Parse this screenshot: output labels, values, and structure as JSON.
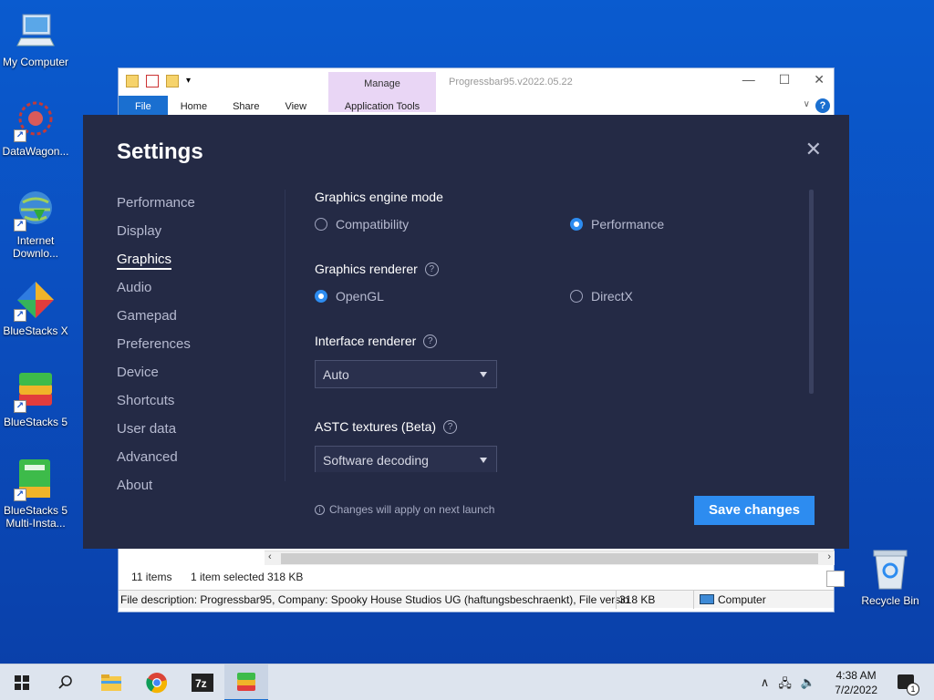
{
  "desktop": {
    "icons": [
      {
        "label": "My Computer"
      },
      {
        "label": "DataWagon..."
      },
      {
        "label": "Internet Downlo..."
      },
      {
        "label": "BlueStacks X"
      },
      {
        "label": "BlueStacks 5"
      },
      {
        "label": "BlueStacks 5 Multi-Insta..."
      }
    ],
    "recycle_bin": "Recycle Bin"
  },
  "explorer": {
    "title": "Progressbar95.v2022.05.22",
    "manage_label": "Manage",
    "tabs": [
      "File",
      "Home",
      "Share",
      "View"
    ],
    "app_tools_label": "Application Tools",
    "status_items": "11 items",
    "status_selected": "1 item selected",
    "status_size": "318 KB",
    "details_text": "File description: Progressbar95, Company: Spooky House Studios UG (haftungsbeschraenkt), File versio",
    "details_size": "318 KB",
    "details_location": "Computer"
  },
  "settings": {
    "title": "Settings",
    "nav": [
      "Performance",
      "Display",
      "Graphics",
      "Audio",
      "Gamepad",
      "Preferences",
      "Device",
      "Shortcuts",
      "User data",
      "Advanced",
      "About"
    ],
    "active_nav": "Graphics",
    "engine_mode": {
      "label": "Graphics engine mode",
      "options": [
        "Compatibility",
        "Performance"
      ],
      "selected": "Performance"
    },
    "renderer": {
      "label": "Graphics renderer",
      "options": [
        "OpenGL",
        "DirectX"
      ],
      "selected": "OpenGL"
    },
    "interface_renderer": {
      "label": "Interface renderer",
      "value": "Auto"
    },
    "astc": {
      "label": "ASTC textures (Beta)",
      "value": "Software decoding"
    },
    "note": "Changes will apply on next launch",
    "save_label": "Save changes"
  },
  "taskbar": {
    "time": "4:38 AM",
    "date": "7/2/2022",
    "notification_count": "1"
  }
}
